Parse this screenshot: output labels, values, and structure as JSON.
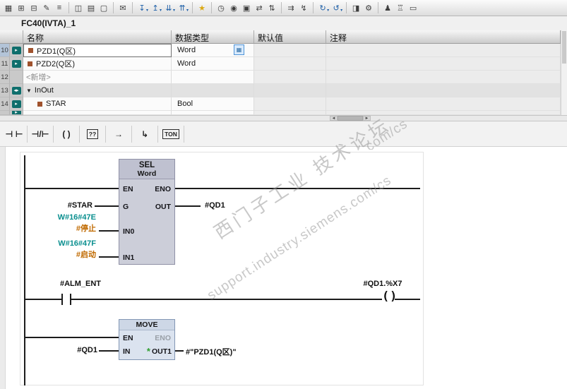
{
  "block": {
    "title": "FC40(IVTA)_1"
  },
  "toolbar": {
    "caret": "▾",
    "icons": [
      {
        "name": "display-mode-icon",
        "glyph": "▦"
      },
      {
        "name": "insert-row-icon",
        "glyph": "⊞"
      },
      {
        "name": "delete-row-icon",
        "glyph": "⊟"
      },
      {
        "name": "edit-icon",
        "glyph": "✎"
      },
      {
        "name": "sort-icon",
        "glyph": "≡"
      },
      {
        "name": "split-view-icon",
        "glyph": "◫"
      },
      {
        "name": "detail-view-icon",
        "glyph": "▤"
      },
      {
        "name": "window-icon",
        "glyph": "▢"
      },
      {
        "name": "comment-icon",
        "glyph": "✉"
      },
      {
        "name": "download-icon",
        "glyph": "↧"
      },
      {
        "name": "upload-icon",
        "glyph": "↥"
      },
      {
        "name": "import-icon",
        "glyph": "⇊"
      },
      {
        "name": "export-icon",
        "glyph": "⇈"
      },
      {
        "name": "favorites-icon",
        "glyph": "★"
      },
      {
        "name": "monitor-clock-icon",
        "glyph": "◷"
      },
      {
        "name": "watch-icon",
        "glyph": "◉"
      },
      {
        "name": "snapshot-icon",
        "glyph": "▣"
      },
      {
        "name": "apply-values-icon",
        "glyph": "⇄"
      },
      {
        "name": "swap-icon",
        "glyph": "⇅"
      },
      {
        "name": "jump-icon",
        "glyph": "⇉"
      },
      {
        "name": "trace-icon",
        "glyph": "↯"
      },
      {
        "name": "go-online-icon",
        "glyph": "↻"
      },
      {
        "name": "go-offline-icon",
        "glyph": "↺"
      },
      {
        "name": "compare-icon",
        "glyph": "◨"
      },
      {
        "name": "settings-icon",
        "glyph": "⚙"
      },
      {
        "name": "user-icon",
        "glyph": "♟"
      },
      {
        "name": "library-icon",
        "glyph": "♖"
      },
      {
        "name": "archive-icon",
        "glyph": "▭"
      }
    ]
  },
  "table": {
    "headers": [
      "名称",
      "数据类型",
      "默认值",
      "注释"
    ],
    "section_triangle": "▼",
    "type_button_glyph": "▦",
    "rows": [
      {
        "num": "10",
        "name": "PZD1(Q区)",
        "type": "Word"
      },
      {
        "num": "11",
        "name": "PZD2(Q区)",
        "type": "Word"
      },
      {
        "num": "12",
        "name": "<新增>",
        "type": ""
      },
      {
        "num": "13",
        "name": "InOut",
        "type": ""
      },
      {
        "num": "14",
        "name": "STAR",
        "type": "Bool"
      },
      {
        "num": "",
        "name": "",
        "type": ""
      }
    ]
  },
  "scrollbar": {
    "left_arrow": "◄",
    "right_arrow": "►"
  },
  "lad_toolbar": {
    "items": [
      {
        "name": "contact-no",
        "glyph": "⊣ ⊢"
      },
      {
        "name": "contact-nc",
        "glyph": "⊣/⊢"
      },
      {
        "name": "coil",
        "glyph": "( )"
      },
      {
        "name": "empty-box",
        "glyph": "??"
      },
      {
        "name": "open-branch",
        "glyph": "→"
      },
      {
        "name": "close-branch",
        "glyph": "↳"
      },
      {
        "name": "timer-ton",
        "glyph": "TON"
      }
    ]
  },
  "ladder": {
    "sel": {
      "title": "SEL",
      "type": "Word",
      "en": "EN",
      "eno": "ENO",
      "g": "G",
      "in0": "IN0",
      "in1": "IN1",
      "out": "OUT"
    },
    "move": {
      "title": "MOVE",
      "en": "EN",
      "eno": "ENO",
      "in": "IN",
      "out1": "OUT1",
      "out_flag": "*"
    },
    "operands": {
      "star": "#STAR",
      "out_qd1": "#QD1",
      "in0_const": "W#16#47E",
      "in0_sym": "#停止",
      "in1_const": "W#16#47F",
      "in1_sym": "#启动",
      "alm": "#ALM_ENT",
      "coil": "#QD1.%X7",
      "move_in": "#QD1",
      "move_out": "#\"PZD1(Q区)\""
    }
  },
  "watermark": {
    "line1": "西门子工业 技术论坛",
    "line2": "support.industry.siemens.com/cs"
  },
  "colors": {
    "constant_teal": "#0a8f8f",
    "symbol_orange": "#c06a00",
    "selection_blue": "#b3c4d8",
    "sel_box_fill": "#ccced9",
    "move_box_fill": "#dbe3ef",
    "icon_teal": "#0e6e6c"
  }
}
